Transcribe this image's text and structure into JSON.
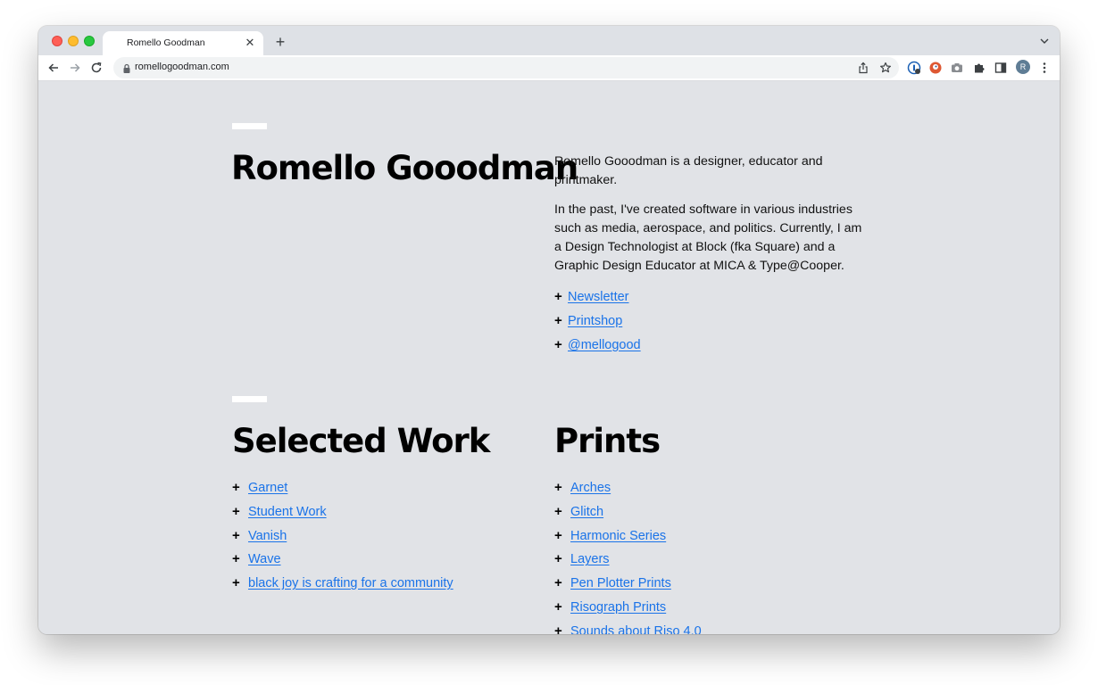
{
  "browser": {
    "tab_title": "Romello Goodman",
    "tab_close": "✕",
    "new_tab": "+",
    "url": "romellogoodman.com",
    "profile_initial": "R",
    "icons": [
      "back-arrow-icon",
      "forward-arrow-icon",
      "reload-icon",
      "lock-icon",
      "share-icon",
      "bookmark-star-icon",
      "extension-1password-icon",
      "extension-duckduckgo-icon",
      "screenshot-camera-icon",
      "extensions-puzzle-icon",
      "side-panel-icon",
      "kebab-menu-icon",
      "tab-search-chevron-icon"
    ]
  },
  "hero": {
    "title": "Romello Gooodman",
    "bio_1": "Romello Gooodman is a designer, educator and printmaker.",
    "bio_2": "In the past, I've created software in various industries such as media, aerospace, and politics. Currently, I am a Design Technologist at Block (fka Square) and a Graphic Design Educator at MICA & Type@Cooper.",
    "links": [
      "Newsletter",
      "Printshop",
      "@mellogood"
    ]
  },
  "selected_work": {
    "title": "Selected Work",
    "items": [
      "Garnet",
      "Student Work",
      "Vanish",
      "Wave",
      "black joy is crafting for a community"
    ]
  },
  "prints": {
    "title": "Prints",
    "items": [
      "Arches",
      "Glitch",
      "Harmonic Series",
      "Layers",
      "Pen Plotter Prints",
      "Risograph Prints",
      "Sounds about Riso 4.0"
    ]
  },
  "colors": {
    "page_background": "#e1e3e7",
    "link": "#1a73e8",
    "rule": "#ffffff"
  }
}
